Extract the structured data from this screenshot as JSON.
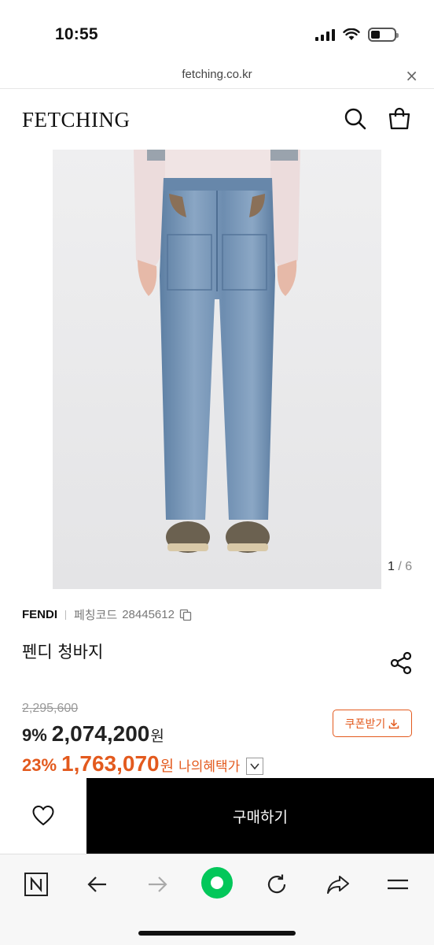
{
  "status_bar": {
    "time": "10:55"
  },
  "url_bar": {
    "url": "fetching.co.kr",
    "close_glyph": "×"
  },
  "header": {
    "logo": "FETCHING",
    "search_icon": "search-icon",
    "bag_icon": "shopping-bag-icon"
  },
  "gallery": {
    "current": "1",
    "separator": "/",
    "total": "6"
  },
  "product": {
    "brand": "FENDI",
    "code_label": "페칭코드",
    "code": "28445612",
    "title": "펜디 청바지"
  },
  "pricing": {
    "original_price": "2,295,600",
    "discount_percent": "9%",
    "discount_price": "2,074,200",
    "max_percent": "23%",
    "max_price": "1,763,070",
    "currency": "원",
    "benefit_label": "나의혜택가",
    "coupon_label": "쿠폰받기"
  },
  "actions": {
    "buy_label": "구매하기"
  },
  "colors": {
    "accent": "#e35a1e",
    "primary": "#000000",
    "naver_green": "#03c75a"
  }
}
